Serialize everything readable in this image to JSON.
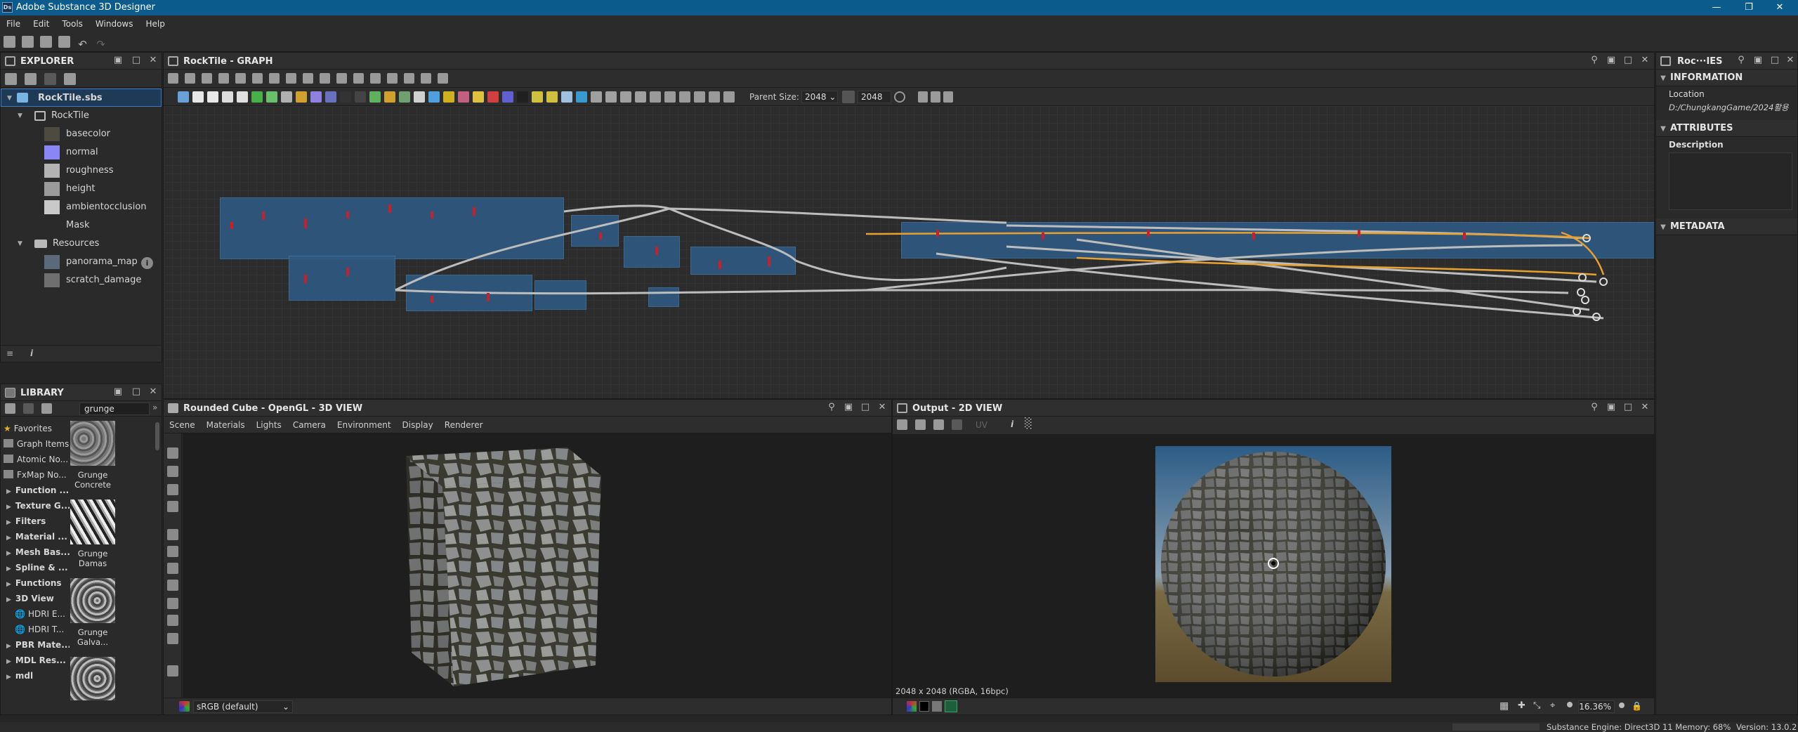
{
  "app": {
    "title": "Adobe Substance 3D Designer",
    "logo": "Ds"
  },
  "menu": [
    "File",
    "Edit",
    "Tools",
    "Windows",
    "Help"
  ],
  "explorer": {
    "title": "EXPLORER",
    "package": "RockTile.sbs",
    "graph": "RockTile",
    "outputs": [
      {
        "label": "basecolor",
        "color": "#4d4a40"
      },
      {
        "label": "normal",
        "color": "#8b86f5"
      },
      {
        "label": "roughness",
        "color": "#b3b3b3"
      },
      {
        "label": "height",
        "color": "#9a9a9a"
      },
      {
        "label": "ambientocclusion",
        "color": "#c9c9c9"
      },
      {
        "label": "Mask",
        "color": ""
      }
    ],
    "resources_label": "Resources",
    "resources": [
      {
        "label": "panorama_map",
        "color": "#5a6a7a"
      },
      {
        "label": "scratch_damage",
        "color": "#6f6f6f"
      }
    ]
  },
  "library": {
    "title": "LIBRARY",
    "search": "grunge",
    "categories": [
      {
        "label": "Favorites",
        "bold": false,
        "icon": "star-icon"
      },
      {
        "label": "Graph Items",
        "bold": false,
        "icon": "graph-icon"
      },
      {
        "label": "Atomic No...",
        "bold": false,
        "icon": "atomic-icon"
      },
      {
        "label": "FxMap No...",
        "bold": false,
        "icon": "fxmap-icon"
      },
      {
        "label": "Function ...",
        "bold": true,
        "icon": ""
      },
      {
        "label": "Texture G...",
        "bold": true,
        "icon": ""
      },
      {
        "label": "Filters",
        "bold": true,
        "icon": ""
      },
      {
        "label": "Material ...",
        "bold": true,
        "icon": ""
      },
      {
        "label": "Mesh Bas...",
        "bold": true,
        "icon": ""
      },
      {
        "label": "Spline & ...",
        "bold": true,
        "icon": ""
      },
      {
        "label": "Functions",
        "bold": true,
        "icon": ""
      },
      {
        "label": "3D View",
        "bold": true,
        "icon": ""
      },
      {
        "label": "HDRI E...",
        "bold": false,
        "icon": "globe-icon"
      },
      {
        "label": "HDRI T...",
        "bold": false,
        "icon": "globe-icon"
      },
      {
        "label": "PBR Mate...",
        "bold": true,
        "icon": ""
      },
      {
        "label": "MDL Res...",
        "bold": true,
        "icon": ""
      },
      {
        "label": "mdl",
        "bold": true,
        "icon": ""
      }
    ],
    "items": [
      {
        "line1": "Grunge",
        "line2": "Concrete"
      },
      {
        "line1": "Grunge",
        "line2": "Damas"
      },
      {
        "line1": "Grunge",
        "line2": "Galva..."
      }
    ]
  },
  "graph": {
    "title": "RockTile - GRAPH",
    "parent_size_label": "Parent Size:",
    "parent_size": "2048",
    "size2": "2048"
  },
  "view3d": {
    "title": "Rounded Cube - OpenGL - 3D VIEW",
    "tabs": [
      "Scene",
      "Materials",
      "Lights",
      "Camera",
      "Environment",
      "Display",
      "Renderer"
    ],
    "colorspace": "sRGB (default)"
  },
  "view2d": {
    "title": "Output - 2D VIEW",
    "info": "2048 x 2048 (RGBA, 16bpc)",
    "uv_label": "UV",
    "zoom": "16.36%"
  },
  "properties": {
    "title": "Roc···IES",
    "information": "INFORMATION",
    "location_label": "Location",
    "location_value": "D:/ChungkangGame/2024활용",
    "attributes": "ATTRIBUTES",
    "description_label": "Description",
    "metadata": "METADATA"
  },
  "status": {
    "engine": "Substance Engine: Direct3D 11  Memory: 68%",
    "version": "Version: 13.0.2"
  }
}
